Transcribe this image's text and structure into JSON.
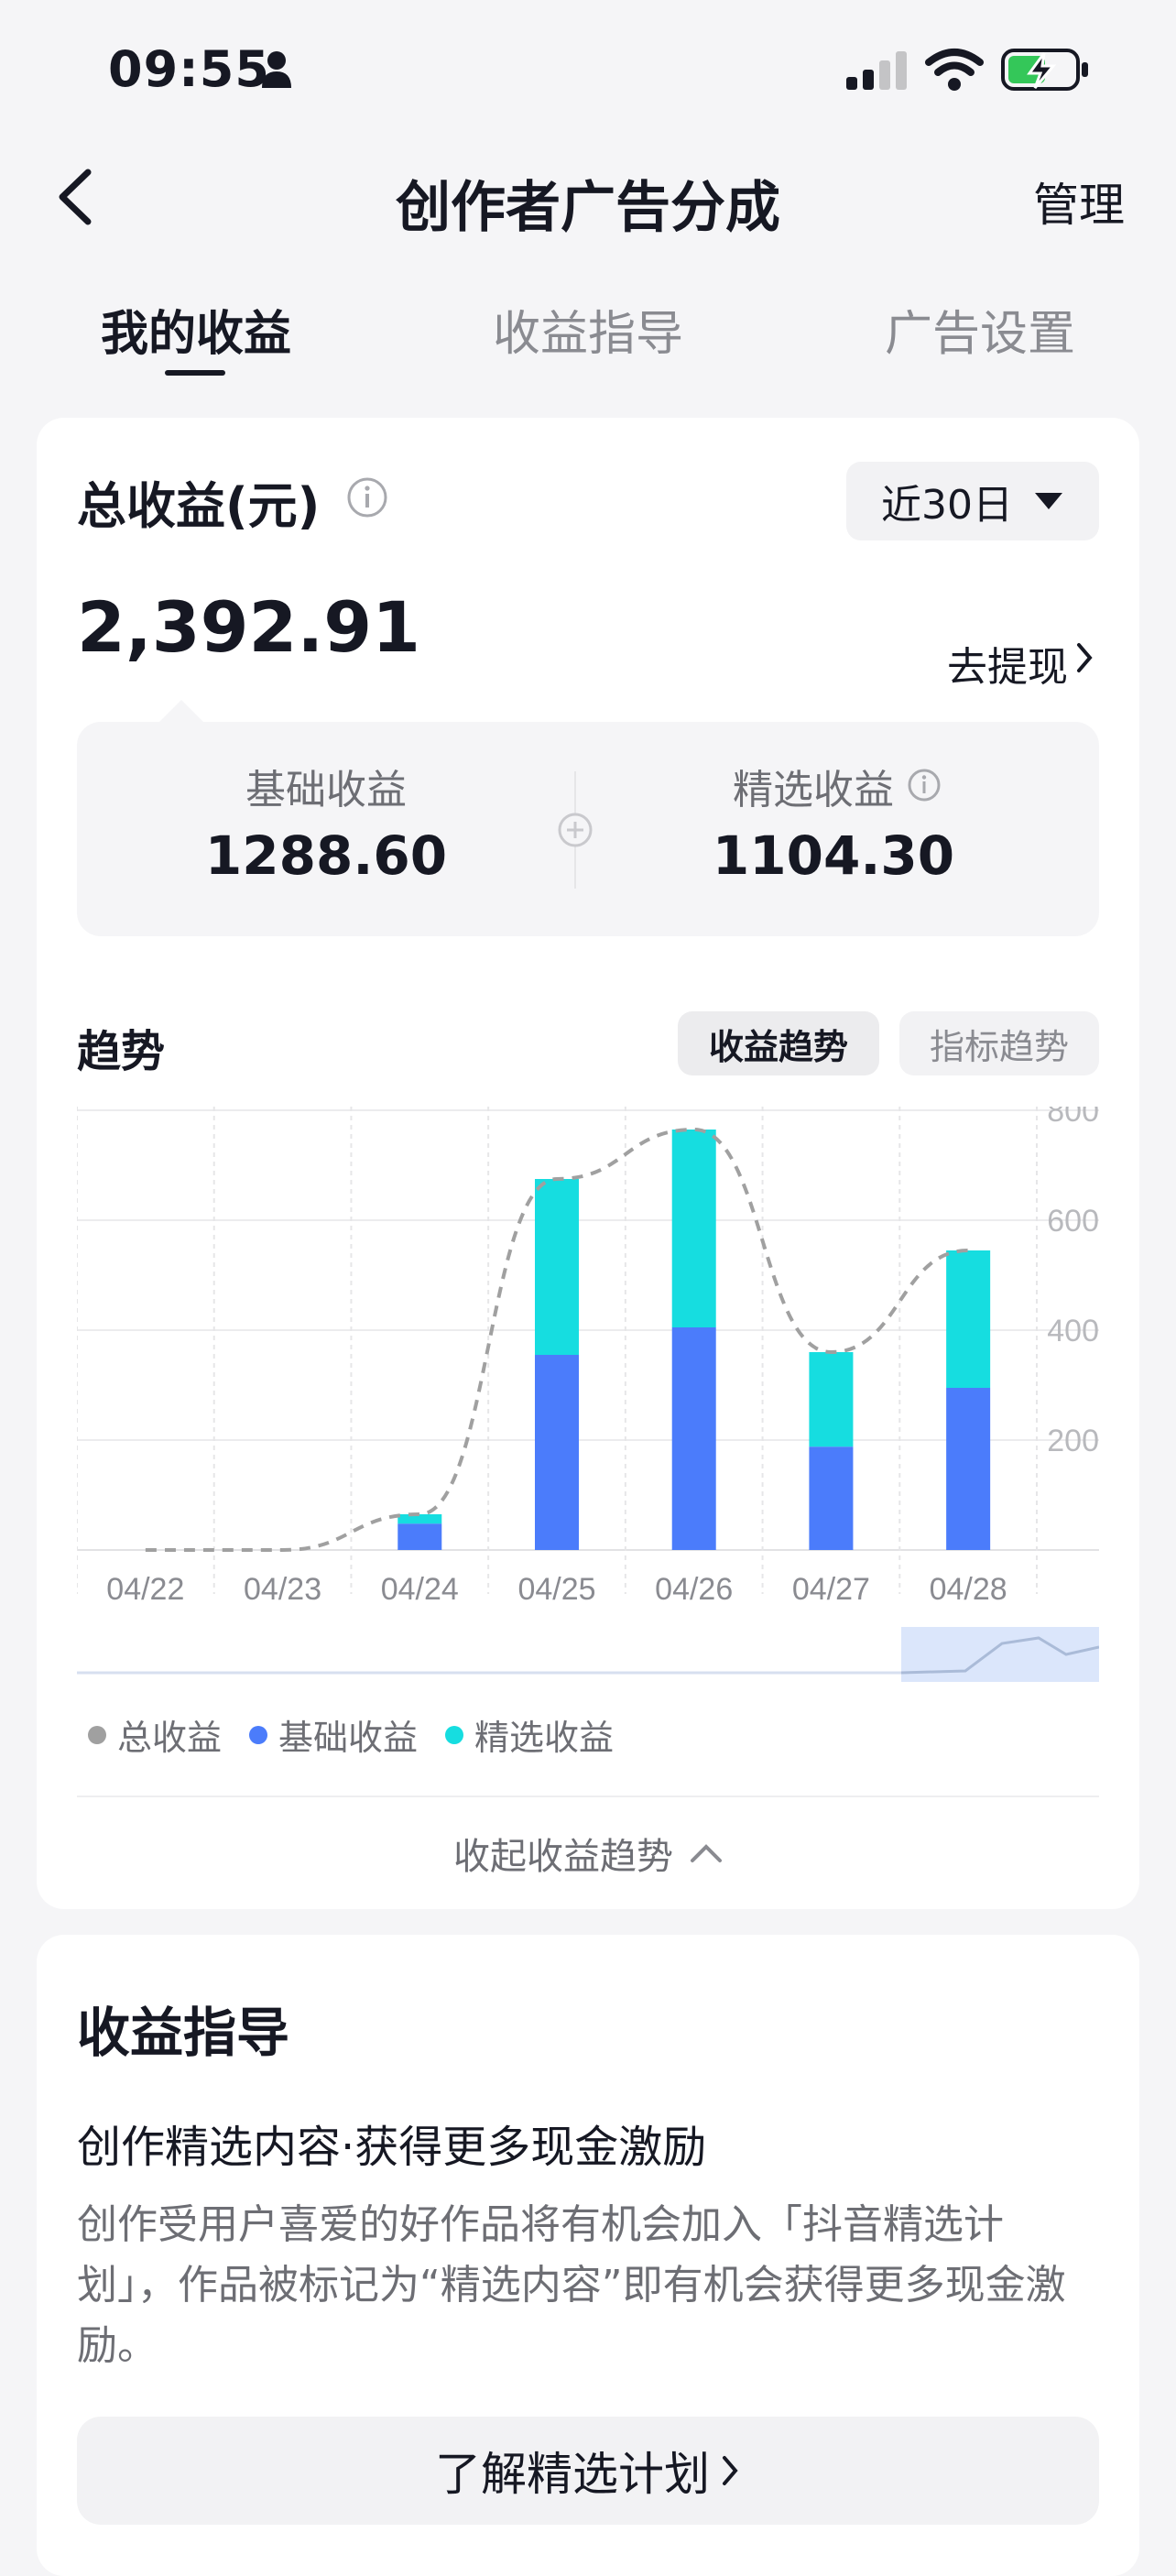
{
  "status_bar": {
    "time": "09:55"
  },
  "nav": {
    "title": "创作者广告分成",
    "right": "管理"
  },
  "tabs": [
    {
      "label": "我的收益",
      "active": true
    },
    {
      "label": "收益指导",
      "active": false
    },
    {
      "label": "广告设置",
      "active": false
    }
  ],
  "earnings": {
    "title": "总收益(元)",
    "period": "近30日",
    "total": "2,392.91",
    "withdraw": "去提现",
    "base_label": "基础收益",
    "base_value": "1288.60",
    "featured_label": "精选收益",
    "featured_value": "1104.30"
  },
  "trend": {
    "title": "趋势",
    "tab_active": "收益趋势",
    "tab_other": "指标趋势",
    "collapse": "收起收益趋势"
  },
  "colors": {
    "base": "#4b7cfb",
    "featured": "#16dde0",
    "total": "#a0a0a0"
  },
  "chart_data": {
    "type": "bar",
    "categories": [
      "04/22",
      "04/23",
      "04/24",
      "04/25",
      "04/26",
      "04/27",
      "04/28"
    ],
    "series": [
      {
        "name": "总收益",
        "values": [
          0,
          0,
          65,
          675,
          765,
          360,
          545
        ]
      },
      {
        "name": "基础收益",
        "values": [
          0,
          0,
          48,
          355,
          405,
          188,
          295
        ]
      },
      {
        "name": "精选收益",
        "values": [
          0,
          0,
          17,
          320,
          360,
          172,
          250
        ]
      }
    ],
    "yticks": [
      "800",
      "600",
      "400",
      "200"
    ],
    "ylim": [
      0,
      800
    ],
    "grid": true,
    "legend": "bottom-left"
  },
  "guide": {
    "title": "收益指导",
    "subtitle": "创作精选内容·获得更多现金激励",
    "body": "创作受用户喜爱的好作品将有机会加入「抖音精选计划」，作品被标记为“精选内容”即有机会获得更多现金激励。",
    "button": "了解精选计划"
  }
}
